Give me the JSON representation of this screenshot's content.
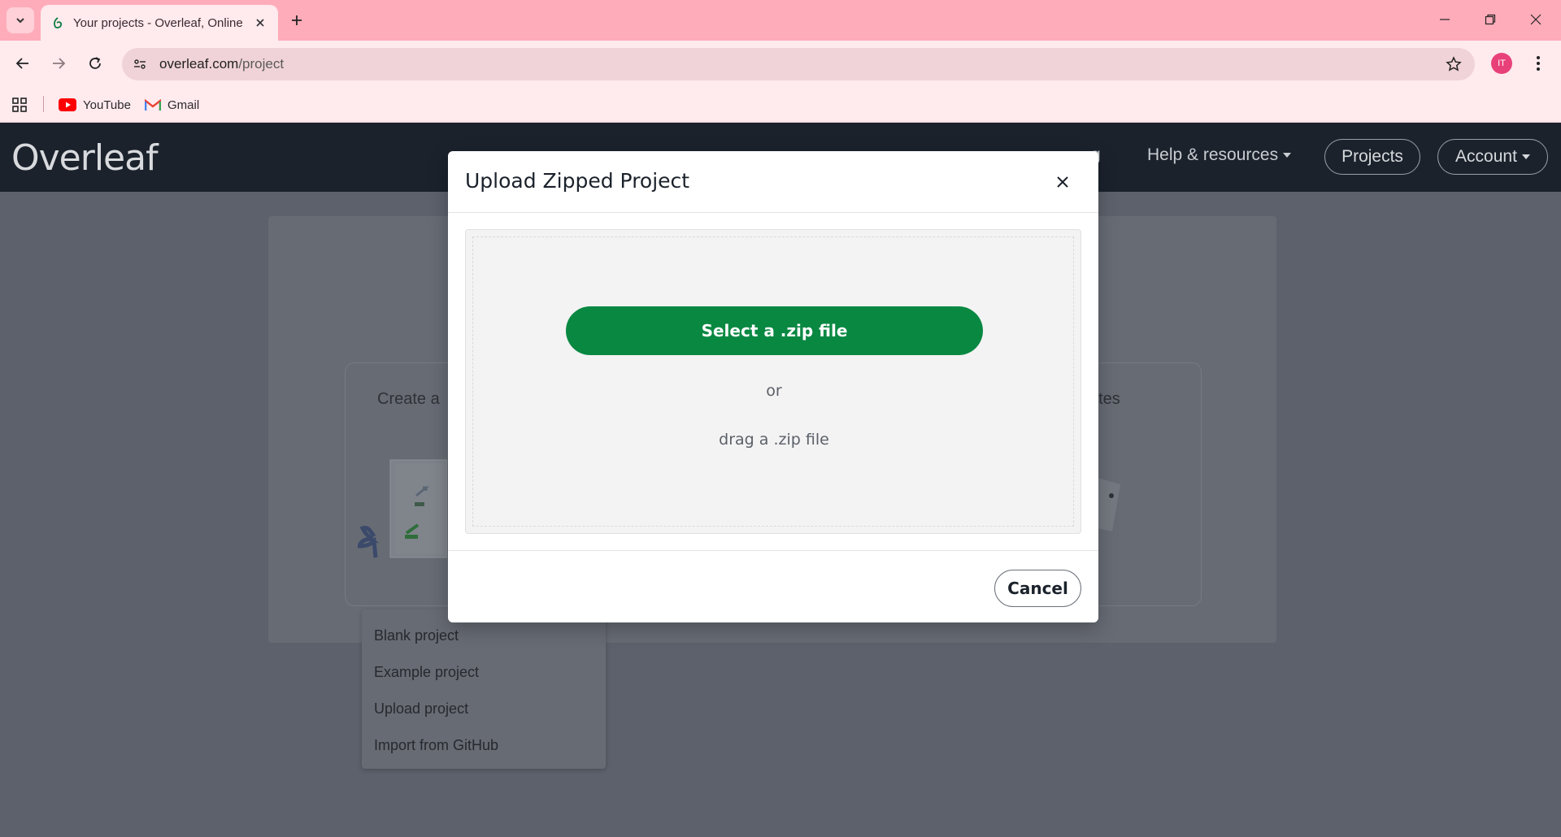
{
  "browser": {
    "tab_title": "Your projects - Overleaf, Online",
    "url_domain": "overleaf.com",
    "url_path": "/project",
    "profile_initials": "IT",
    "bookmarks": [
      {
        "label": "YouTube",
        "icon": "youtube-icon"
      },
      {
        "label": "Gmail",
        "icon": "gmail-icon"
      }
    ]
  },
  "overleaf": {
    "logo": "Overleaf",
    "nav_partial": "g",
    "nav_help": "Help & resources",
    "nav_projects": "Projects",
    "nav_account": "Account",
    "create_partial_left": "Create a",
    "create_partial_right": "ates",
    "new_project_menu": [
      "Blank project",
      "Example project",
      "Upload project",
      "Import from GitHub"
    ]
  },
  "modal": {
    "title": "Upload Zipped Project",
    "select_button": "Select a .zip file",
    "or_text": "or",
    "drag_text": "drag a .zip file",
    "cancel_button": "Cancel"
  },
  "colors": {
    "tabstrip": "#ffacba",
    "toolbar": "#ffeaee",
    "overleaf_header": "#1b222c",
    "primary_green": "#098842",
    "profile": "#e8417a"
  }
}
